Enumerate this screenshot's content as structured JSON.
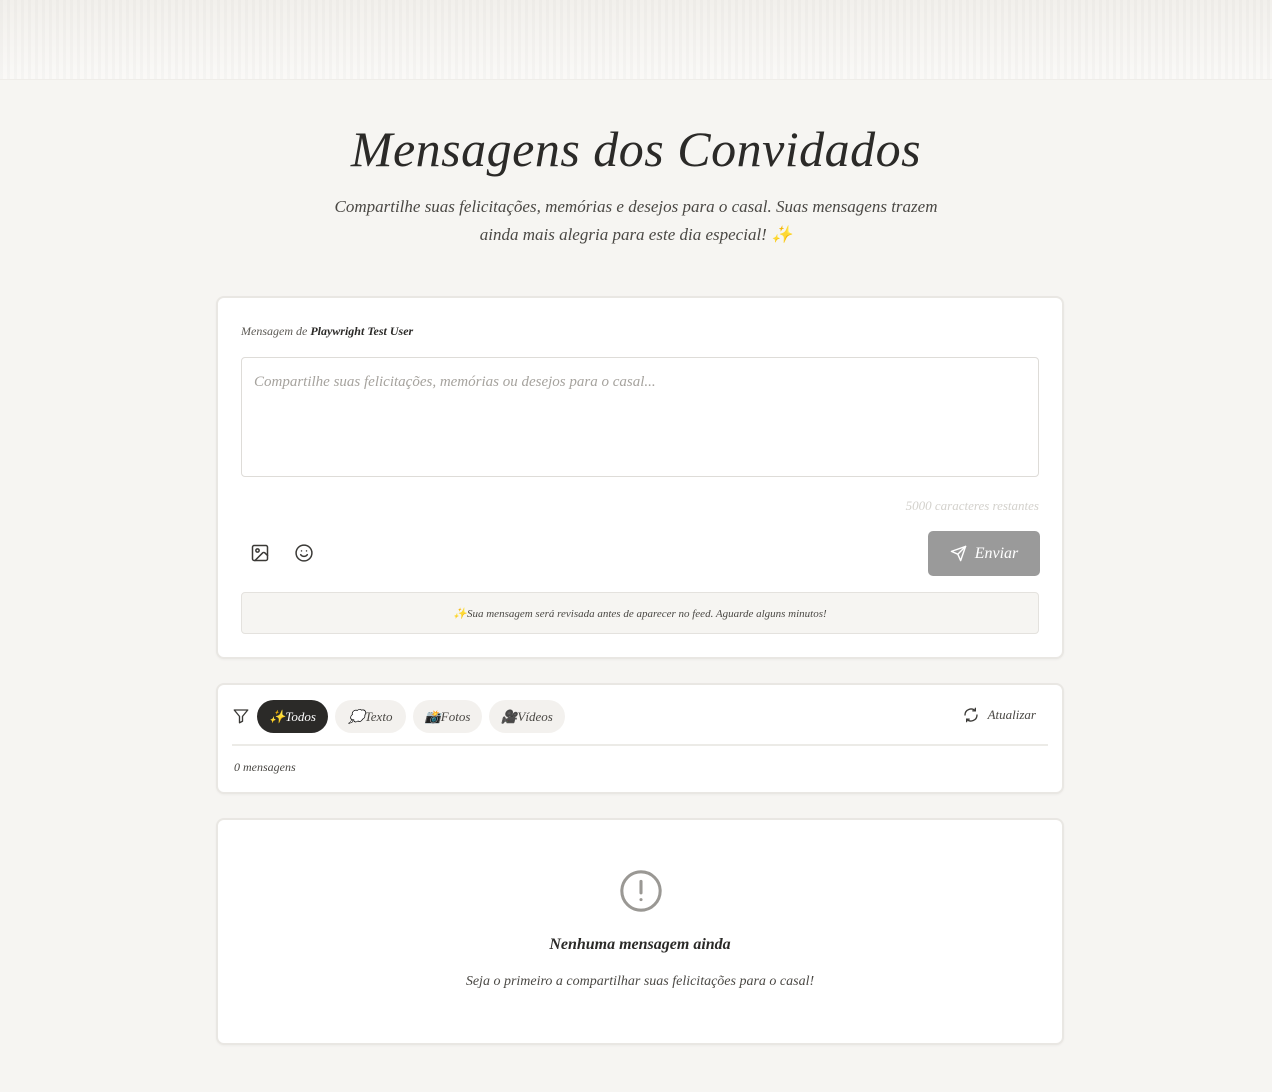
{
  "header": {
    "title": "Mensagens dos Convidados",
    "subtitle": "Compartilhe suas felicitações, memórias e desejos para o casal. Suas mensagens trazem ainda mais alegria para este dia especial! ✨"
  },
  "compose": {
    "author_prefix": "Mensagem de",
    "author_name": "Playwright Test User",
    "placeholder": "Compartilhe suas felicitações, memórias ou desejos para o casal...",
    "value": "",
    "char_count": "5000 caracteres restantes",
    "send_label": "Enviar",
    "notice": "✨Sua mensagem será revisada antes de aparecer no feed. Aguarde alguns minutos!",
    "icons": [
      "image-icon",
      "smile-icon",
      "send-icon"
    ]
  },
  "filters": {
    "icon": "filter-icon",
    "chips": [
      {
        "label": "✨Todos",
        "active": true
      },
      {
        "label": "💭Texto",
        "active": false
      },
      {
        "label": "📸Fotos",
        "active": false
      },
      {
        "label": "🎥Vídeos",
        "active": false
      }
    ],
    "refresh_label": "Atualizar",
    "count": "0 mensagens"
  },
  "empty": {
    "icon": "alert-circle-icon",
    "title": "Nenhuma mensagem ainda",
    "text": "Seja o primeiro a compartilhar suas felicitações para o casal!"
  },
  "colors": {
    "background": "#f6f5f2",
    "text": "#2b2a28",
    "active_chip": "#2b2a28",
    "send_button": "#9a9a9a"
  }
}
